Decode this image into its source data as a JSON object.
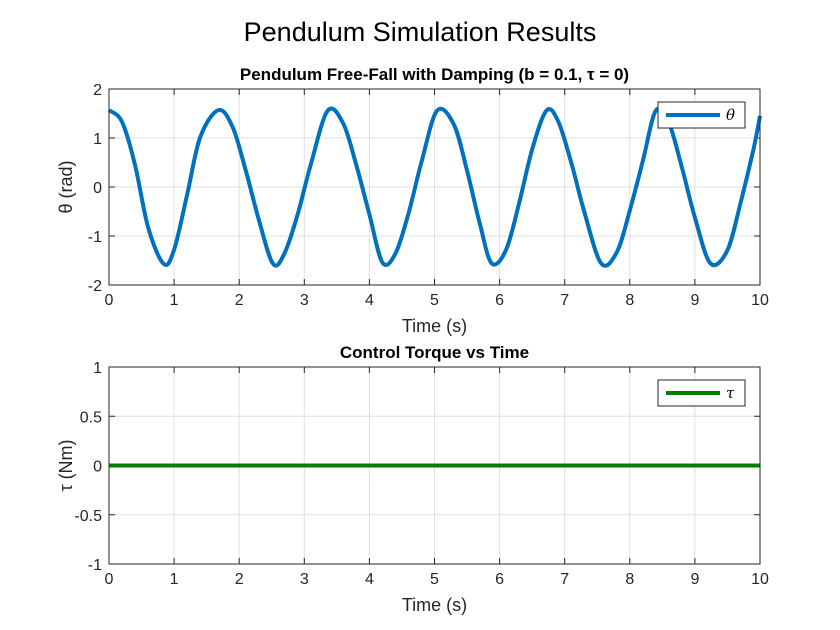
{
  "figure_title": "Pendulum Simulation Results",
  "chart_data": [
    {
      "type": "line",
      "title": "Pendulum Free-Fall with Damping (b = 0.1, τ = 0)",
      "xlabel": "Time (s)",
      "ylabel": "θ (rad)",
      "xlim": [
        0,
        10
      ],
      "ylim": [
        -2,
        2
      ],
      "xticks": [
        "0",
        "1",
        "2",
        "3",
        "4",
        "5",
        "6",
        "7",
        "8",
        "9",
        "10"
      ],
      "yticks": [
        "-2",
        "-1",
        "0",
        "1",
        "2"
      ],
      "grid": true,
      "legend_position": "top-right",
      "series": [
        {
          "name": "θ",
          "color": "#0072BD",
          "x": [
            0,
            0.2,
            0.4,
            0.6,
            0.84,
            1.0,
            1.2,
            1.4,
            1.68,
            1.9,
            2.1,
            2.3,
            2.52,
            2.7,
            2.9,
            3.1,
            3.36,
            3.6,
            3.8,
            4.0,
            4.2,
            4.4,
            4.6,
            4.8,
            5.04,
            5.3,
            5.5,
            5.7,
            5.88,
            6.1,
            6.3,
            6.5,
            6.72,
            6.9,
            7.1,
            7.3,
            7.56,
            7.8,
            8.0,
            8.2,
            8.4,
            8.6,
            8.8,
            9.0,
            9.24,
            9.5,
            9.7,
            9.9,
            10.0
          ],
          "y": [
            1.57,
            1.33,
            0.45,
            -0.82,
            -1.57,
            -1.28,
            -0.16,
            1.01,
            1.57,
            1.22,
            0.34,
            -0.66,
            -1.57,
            -1.34,
            -0.55,
            0.46,
            1.56,
            1.29,
            0.44,
            -0.56,
            -1.54,
            -1.36,
            -0.54,
            0.51,
            1.56,
            1.27,
            0.33,
            -0.77,
            -1.56,
            -1.28,
            -0.33,
            0.77,
            1.56,
            1.34,
            0.5,
            -0.5,
            -1.56,
            -1.33,
            -0.48,
            0.53,
            1.56,
            1.31,
            0.4,
            -0.62,
            -1.56,
            -1.29,
            -0.33,
            0.77,
            1.45
          ]
        }
      ]
    },
    {
      "type": "line",
      "title": "Control Torque vs Time",
      "xlabel": "Time (s)",
      "ylabel": "τ (Nm)",
      "xlim": [
        0,
        10
      ],
      "ylim": [
        -1,
        1
      ],
      "xticks": [
        "0",
        "1",
        "2",
        "3",
        "4",
        "5",
        "6",
        "7",
        "8",
        "9",
        "10"
      ],
      "yticks": [
        "-1",
        "-0.5",
        "0",
        "0.5",
        "1"
      ],
      "grid": true,
      "legend_position": "top-right",
      "series": [
        {
          "name": "τ",
          "color": "#008000",
          "x": [
            0,
            10
          ],
          "y": [
            0,
            0
          ]
        }
      ]
    }
  ]
}
